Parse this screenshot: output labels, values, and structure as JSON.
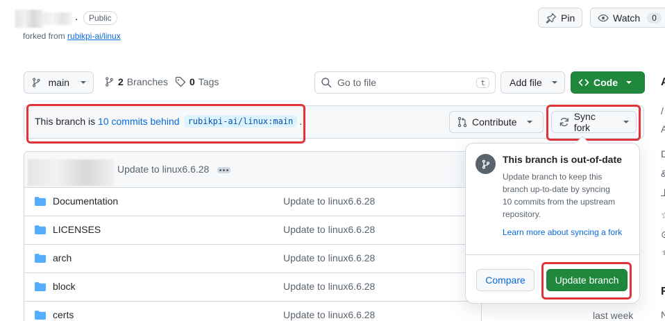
{
  "repo": {
    "visibility": "Public",
    "forked_from_prefix": "forked from ",
    "forked_from_link": "rubikpi-ai/linux",
    "separator": "."
  },
  "header_actions": {
    "pin_label": "Pin",
    "watch_label": "Watch",
    "watch_count": "0"
  },
  "toolbar": {
    "branch": "main",
    "branches_count": "2",
    "branches_label": "Branches",
    "tags_count": "0",
    "tags_label": "Tags",
    "go_to_file_placeholder": "Go to file",
    "go_to_file_shortcut": "t",
    "add_file_label": "Add file",
    "code_label": "Code"
  },
  "branch_status": {
    "prefix": "This branch is ",
    "commits_link": "10 commits behind",
    "upstream": "rubikpi-ai/linux:main",
    "suffix": ".",
    "contribute_label": "Contribute",
    "sync_fork_label": "Sync fork"
  },
  "latest_commit": {
    "message": "Update to linux6.6.28"
  },
  "files": [
    {
      "name": "Documentation",
      "message": "Update to linux6.6.28",
      "time": ""
    },
    {
      "name": "LICENSES",
      "message": "Update to linux6.6.28",
      "time": ""
    },
    {
      "name": "arch",
      "message": "Update to linux6.6.28",
      "time": ""
    },
    {
      "name": "block",
      "message": "Update to linux6.6.28",
      "time": ""
    },
    {
      "name": "certs",
      "message": "Update to linux6.6.28",
      "time": "last week"
    }
  ],
  "popover": {
    "title": "This branch is out-of-date",
    "body": "Update branch to keep this branch up-to-date by syncing 10 commits from the upstream repository.",
    "learn_more": "Learn more about syncing a fork",
    "compare_label": "Compare",
    "update_label": "Update branch"
  },
  "right_edge": {
    "heading_char": "A",
    "section_char": "R",
    "fragments": [
      "/",
      "A",
      "D",
      "&",
      "⅃",
      "☆",
      "⊙",
      "♆",
      "N"
    ]
  },
  "colors": {
    "accent_link": "#0969da",
    "primary_green": "#1f883d",
    "highlight_red": "#e0333a",
    "folder_blue": "#54aeff"
  }
}
